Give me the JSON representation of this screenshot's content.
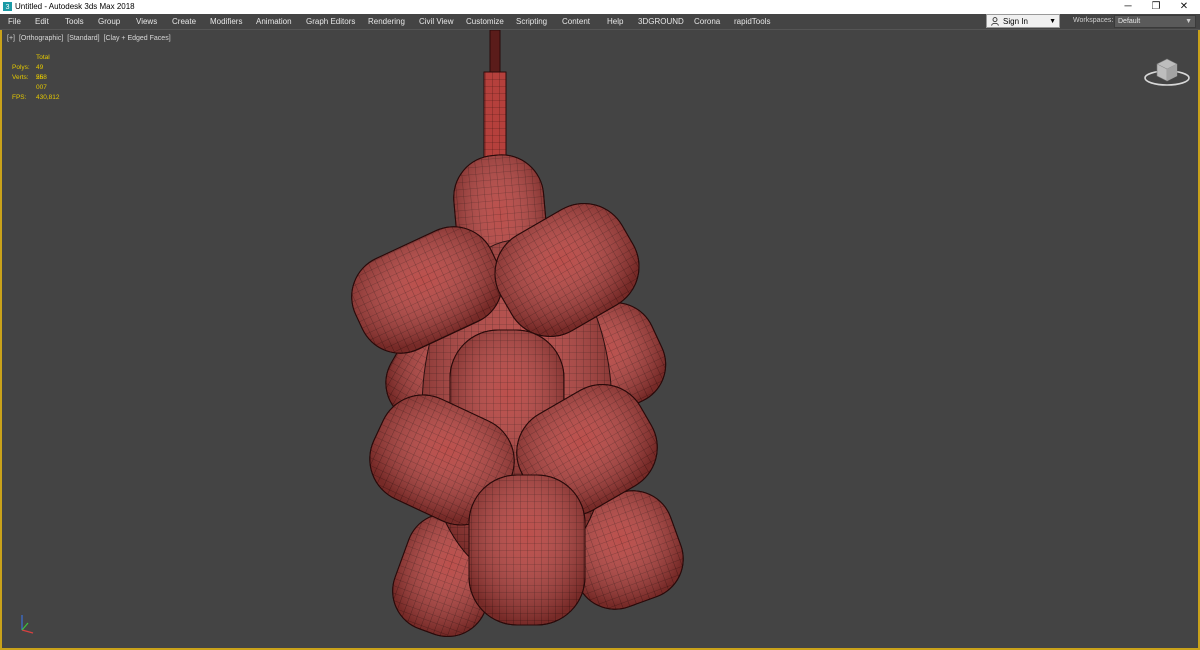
{
  "titlebar": {
    "title": "Untitled - Autodesk 3ds Max 2018",
    "controls": [
      "─",
      "❐",
      "✕"
    ]
  },
  "menu": {
    "items": [
      "File",
      "Edit",
      "Tools",
      "Group",
      "Views",
      "Create",
      "Modifiers",
      "Animation",
      "Graph Editors",
      "Rendering",
      "Civil View",
      "Customize",
      "Scripting",
      "Content",
      "Help",
      "3DGROUND",
      "Corona",
      "rapidTools"
    ]
  },
  "account": {
    "signin_label": "Sign In"
  },
  "workspaces": {
    "label": "Workspaces:",
    "value": "Default"
  },
  "viewport": {
    "labels": [
      "[+]",
      "[Orthographic]",
      "[Standard]",
      "[Clay + Edged Faces]"
    ],
    "stats": {
      "header": "Total",
      "polys_label": "Polys:",
      "polys_value": "49 568",
      "verts_label": "Verts:",
      "verts_value": "25 007",
      "fps_label": "FPS:",
      "fps_value": "430,812"
    }
  },
  "icons": {
    "app": "3dsmax-logo-icon",
    "user": "user-icon",
    "viewcube": "viewcube-icon",
    "axis": "axis-tripod-icon"
  },
  "colors": {
    "accent": "#c9a21a",
    "stats_text": "#e5c900",
    "model": "#b5403c",
    "viewport_bg": "#444444"
  }
}
